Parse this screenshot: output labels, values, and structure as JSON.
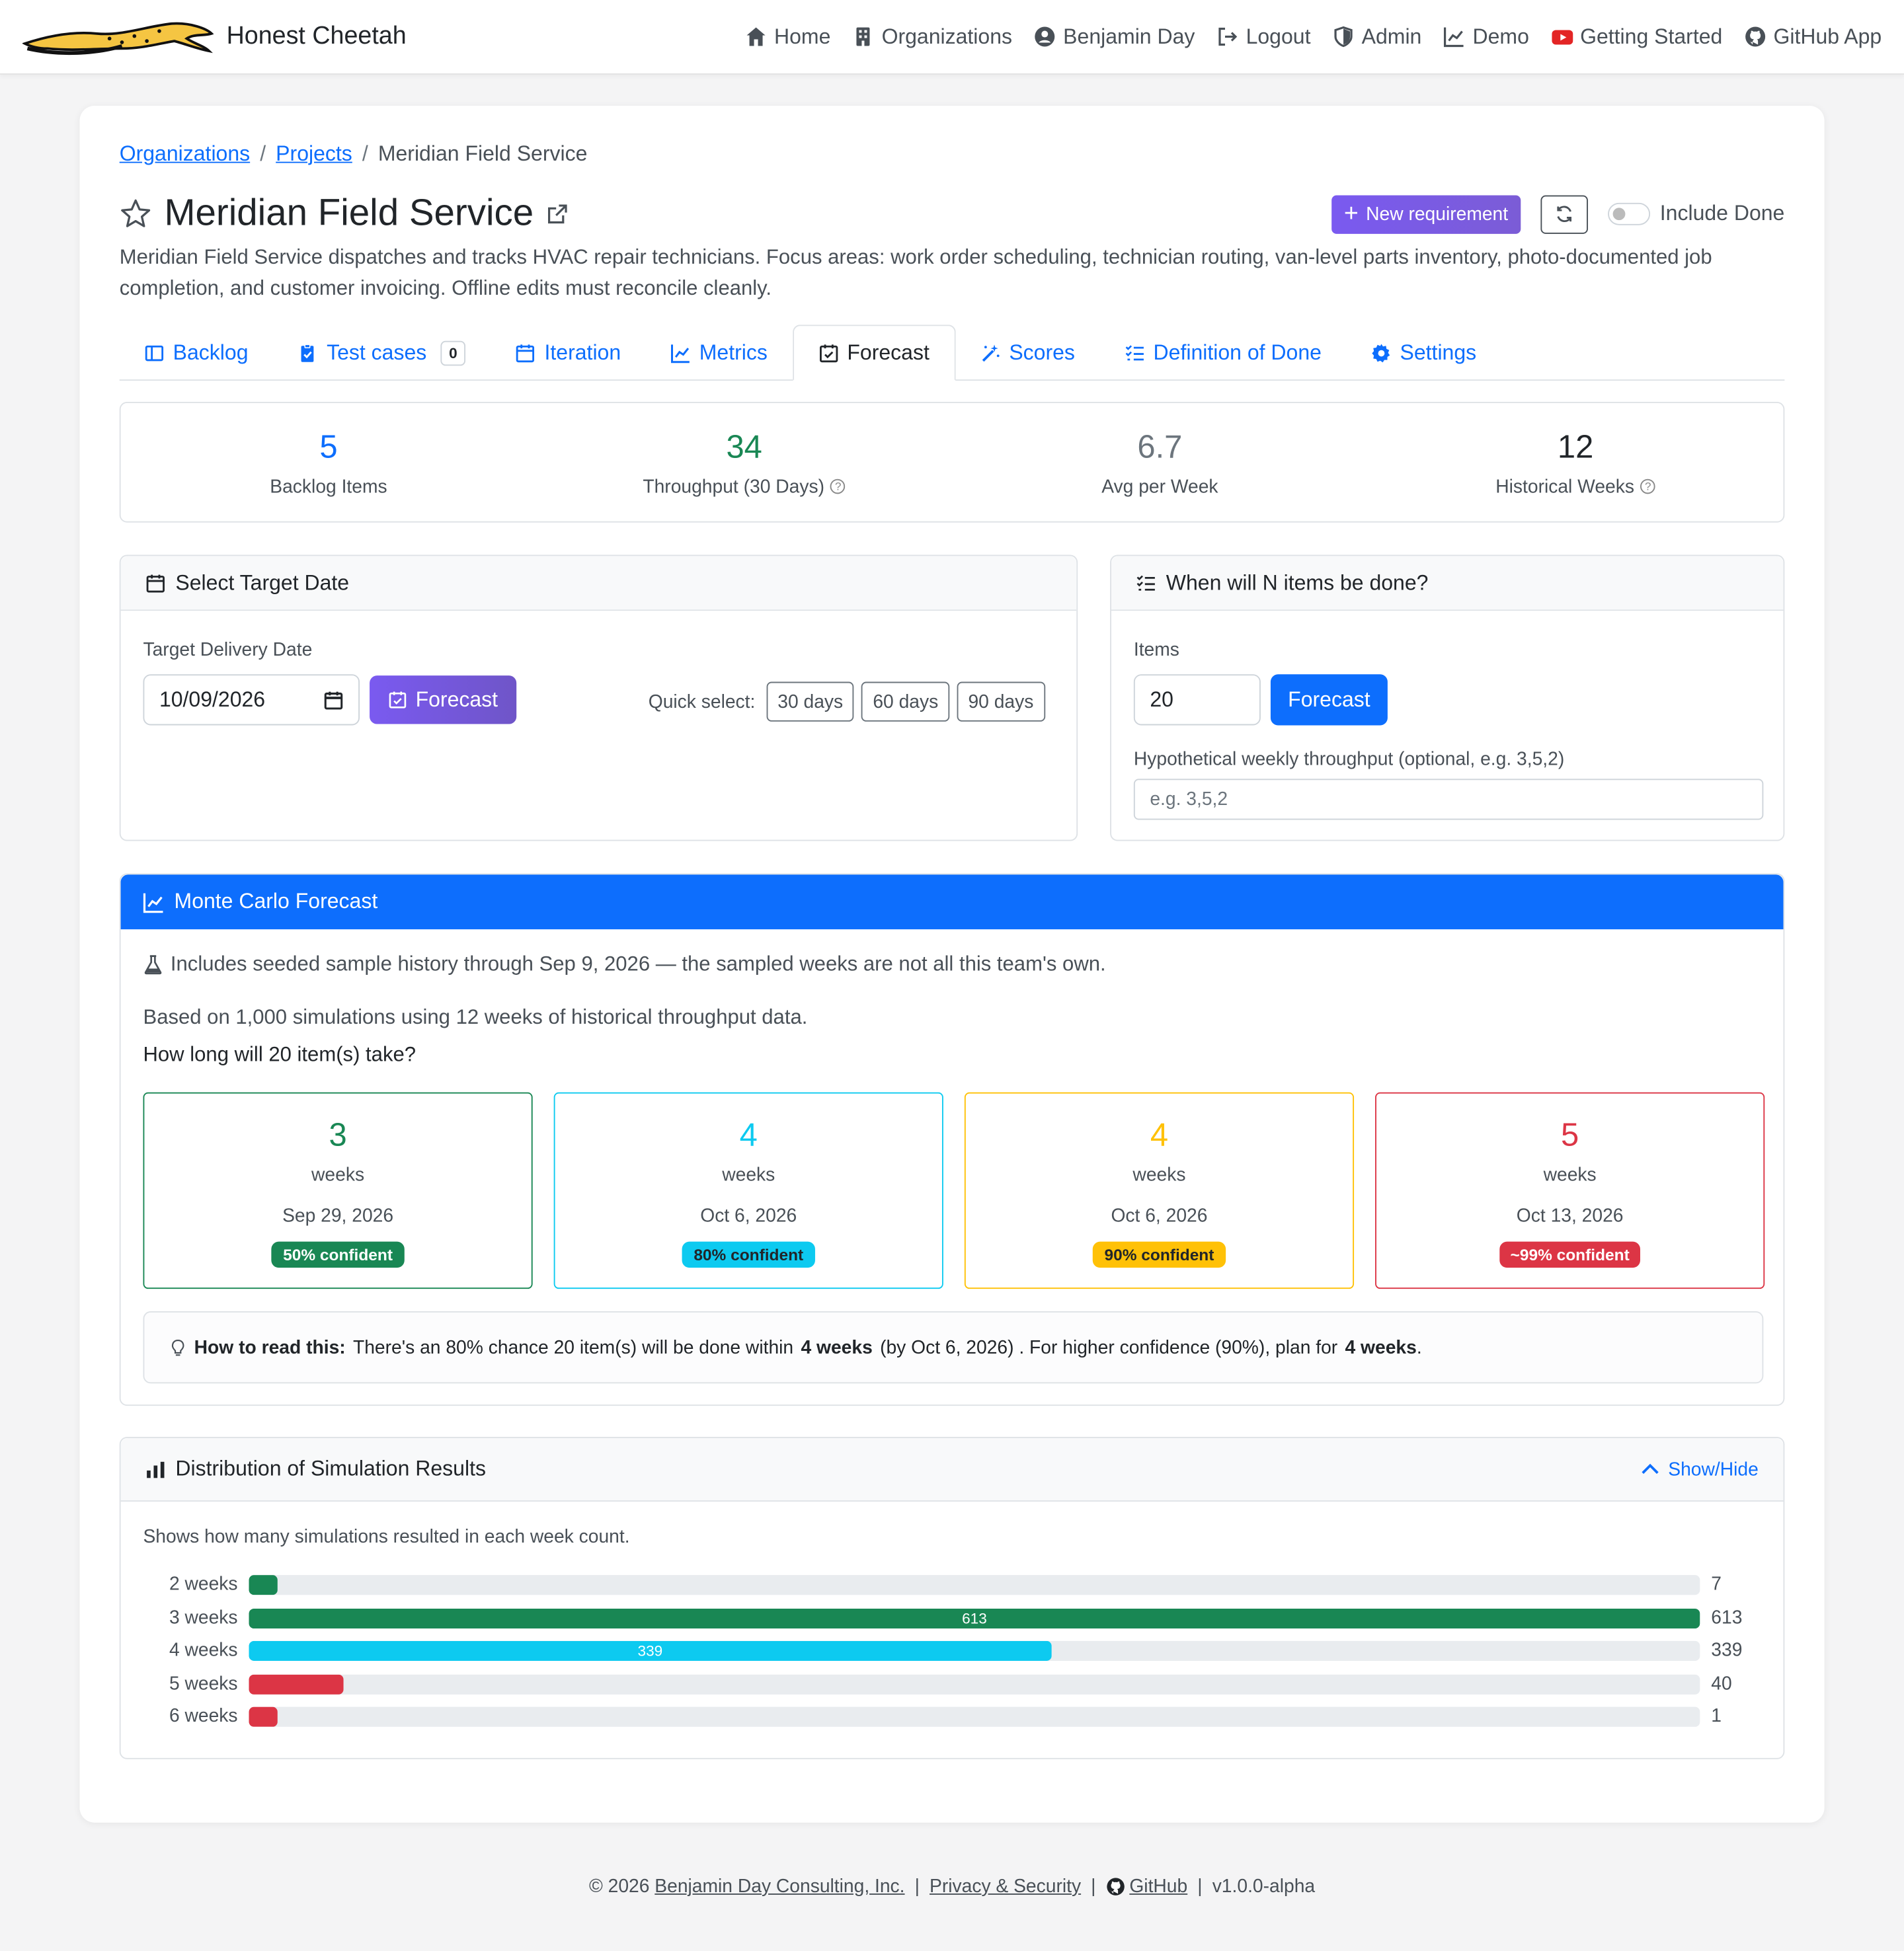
{
  "nav": {
    "brand": "Honest Cheetah",
    "links": [
      "Home",
      "Organizations",
      "Benjamin Day",
      "Logout",
      "Admin",
      "Demo",
      "Getting Started",
      "GitHub App"
    ]
  },
  "breadcrumb": {
    "org": "Organizations",
    "projects": "Projects",
    "current": "Meridian Field Service"
  },
  "project": {
    "title": "Meridian Field Service",
    "description": "Meridian Field Service dispatches and tracks HVAC repair technicians. Focus areas: work order scheduling, technician routing, van-level parts inventory, photo-documented job completion, and customer invoicing. Offline edits must reconcile cleanly.",
    "new_requirement": "New requirement",
    "include_done": "Include Done"
  },
  "tabs": {
    "backlog": "Backlog",
    "test_cases": "Test cases",
    "test_cases_count": "0",
    "iteration": "Iteration",
    "metrics": "Metrics",
    "forecast": "Forecast",
    "scores": "Scores",
    "dod": "Definition of Done",
    "settings": "Settings"
  },
  "stats": {
    "backlog_value": "5",
    "backlog_label": "Backlog Items",
    "throughput_value": "34",
    "throughput_label": "Throughput (30 Days)",
    "avg_value": "6.7",
    "avg_label": "Avg per Week",
    "weeks_value": "12",
    "weeks_label": "Historical Weeks",
    "colors": {
      "blue": "#0d6efd",
      "green": "#198754",
      "gray": "#6c757d",
      "dark": "#212529"
    }
  },
  "target_date": {
    "header": "Select Target Date",
    "label": "Target Delivery Date",
    "value": "10/09/2026",
    "forecast_button": "Forecast",
    "quick_select": "Quick select:",
    "quick": [
      "30 days",
      "60 days",
      "90 days"
    ]
  },
  "n_items": {
    "header": "When will N items be done?",
    "items_label": "Items",
    "items_value": "20",
    "forecast_button": "Forecast",
    "throughput_label": "Hypothetical weekly throughput (optional, e.g. 3,5,2)",
    "throughput_placeholder": "e.g. 3,5,2"
  },
  "monte_carlo": {
    "header": "Monte Carlo Forecast",
    "seeded_note": "Includes seeded sample history through Sep 9, 2026 — the sampled weeks are not all this team's own.",
    "basis": "Based on 1,000 simulations using 12 weeks of historical throughput data.",
    "question": "How long will 20 item(s) take?",
    "unit": "weeks",
    "results": [
      {
        "weeks": "3",
        "date": "Sep 29, 2026",
        "badge": "50% confident",
        "color": "#198754"
      },
      {
        "weeks": "4",
        "date": "Oct 6, 2026",
        "badge": "80% confident",
        "color": "#0dcaf0"
      },
      {
        "weeks": "4",
        "date": "Oct 6, 2026",
        "badge": "90% confident",
        "color": "#ffc107"
      },
      {
        "weeks": "5",
        "date": "Oct 13, 2026",
        "badge": "~99% confident",
        "color": "#dc3545"
      }
    ],
    "tip_bold": "How to read this:",
    "tip_1": "There's an 80% chance 20 item(s) will be done within",
    "tip_w1": "4 weeks",
    "tip_2": "(by Oct 6, 2026) . For higher confidence (90%), plan for",
    "tip_w2": "4 weeks",
    "tip_end": "."
  },
  "distribution": {
    "header": "Distribution of Simulation Results",
    "toggle": "Show/Hide",
    "caption": "Shows how many simulations resulted in each week count.",
    "max": 613,
    "rows": [
      {
        "label": "2 weeks",
        "count": 7,
        "count_text": "7",
        "color": "#198754",
        "show_inner": false
      },
      {
        "label": "3 weeks",
        "count": 613,
        "count_text": "613",
        "color": "#198754",
        "show_inner": true
      },
      {
        "label": "4 weeks",
        "count": 339,
        "count_text": "339",
        "color": "#0dcaf0",
        "show_inner": true
      },
      {
        "label": "5 weeks",
        "count": 40,
        "count_text": "40",
        "color": "#dc3545",
        "show_inner": false
      },
      {
        "label": "6 weeks",
        "count": 1,
        "count_text": "1",
        "color": "#dc3545",
        "show_inner": false
      }
    ]
  },
  "footer": {
    "copyright": "© 2026",
    "company": "Benjamin Day Consulting, Inc.",
    "privacy": "Privacy & Security",
    "github": "GitHub",
    "version": "v1.0.0-alpha"
  }
}
